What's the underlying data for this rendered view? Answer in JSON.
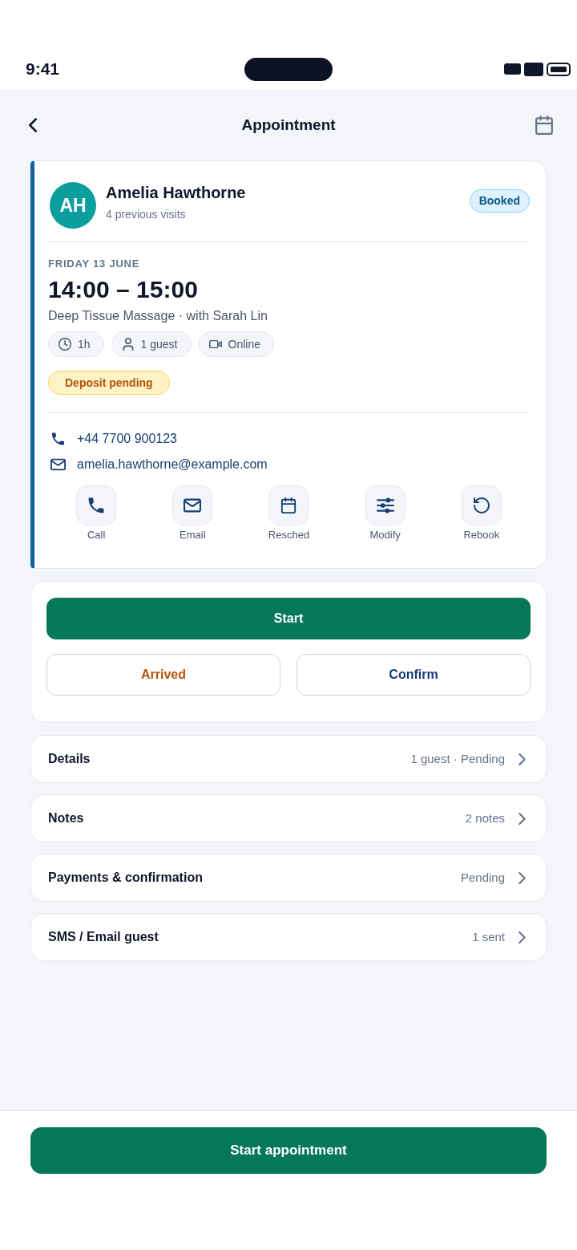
{
  "status_bar": {
    "time": "9:41"
  },
  "header": {
    "title": "Appointment"
  },
  "client": {
    "initials": "AH",
    "name": "Amelia Hawthorne",
    "visits": "4 previous visits",
    "status": "Booked"
  },
  "appointment": {
    "date": "FRIDAY 13 JUNE",
    "time": "14:00 – 15:00",
    "service": "Deep Tissue Massage · with Sarah Lin",
    "chips": [
      {
        "kind": "duration",
        "label": "1h"
      },
      {
        "kind": "guests",
        "label": "1 guest"
      },
      {
        "kind": "online",
        "label": "Online"
      }
    ],
    "deposit": "Deposit pending"
  },
  "contacts": [
    {
      "kind": "phone",
      "value": "+44 7700 900123"
    },
    {
      "kind": "email",
      "value": "amelia.hawthorne@example.com"
    }
  ],
  "quick_actions": [
    {
      "kind": "call",
      "label": "Call"
    },
    {
      "kind": "email",
      "label": "Email"
    },
    {
      "kind": "reschedule",
      "label": "Resched"
    },
    {
      "kind": "modify",
      "label": "Modify"
    },
    {
      "kind": "rebook",
      "label": "Rebook"
    }
  ],
  "actions": {
    "primary": "Start",
    "secondary": [
      {
        "kind": "arrived",
        "label": "Arrived"
      },
      {
        "kind": "confirm",
        "label": "Confirm"
      }
    ]
  },
  "sections": [
    {
      "title": "Details",
      "value": "1 guest · Pending"
    },
    {
      "title": "Notes",
      "value": "2 notes"
    },
    {
      "title": "Payments & confirmation",
      "value": "Pending"
    },
    {
      "title": "SMS / Email guest",
      "value": "1 sent"
    }
  ],
  "footer": {
    "button": "Start appointment"
  }
}
